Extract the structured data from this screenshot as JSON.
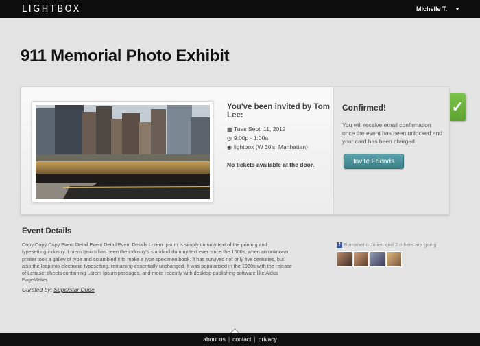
{
  "header": {
    "logo": "LIGHTBOX",
    "user_name": "Michelle T."
  },
  "page_title": "911 Memorial Photo Exhibit",
  "invite": {
    "title": "You've been invited by Tom Lee:",
    "date": "Tues Sept. 11, 2012",
    "time": "9:00p - 1:00a",
    "location": "lightbox (W 30's, Manhattan)",
    "tickets_note": "No tickets available at the door.",
    "icons": [
      "calendar-icon",
      "clock-icon",
      "location-icon"
    ]
  },
  "confirmation": {
    "heading": "Confirmed!",
    "text": "You will receive email confirmation once the event has been unlocked and your card has been charged.",
    "button_label": "Invite Friends",
    "check_symbol": "✓"
  },
  "event_details": {
    "heading": "Event Details",
    "body": "Copy Copy Copy Event Detail Event Detail Event Details Lorem Ipsum is simply dummy text of the printing and typesetting industry. Lorem Ipsum has been the industry's standard dummy text ever since the 1500s, when an unknown printer took a galley of type and scrambled it to make a type specimen book. It has survived not only five centuries, but also the leap into electronic typesetting, remaining essentially unchanged. It was popularised in the 1960s with the release of Letraset sheets containing Lorem Ipsum passages, and more recently with desktop publishing software like Aldus PageMaker.",
    "curated_label": "Curated by:",
    "curator": "Superstar Dude"
  },
  "attendees": {
    "text": "Romanetto Julien and 2 others are going."
  },
  "footer": {
    "links": [
      "about us",
      "contact",
      "privacy"
    ],
    "separator": "|"
  },
  "colors": {
    "accent_button": "#4a919b",
    "check_green": "#6cb33c",
    "topbar": "#0e0e0e",
    "background": "#e3e3e3"
  }
}
